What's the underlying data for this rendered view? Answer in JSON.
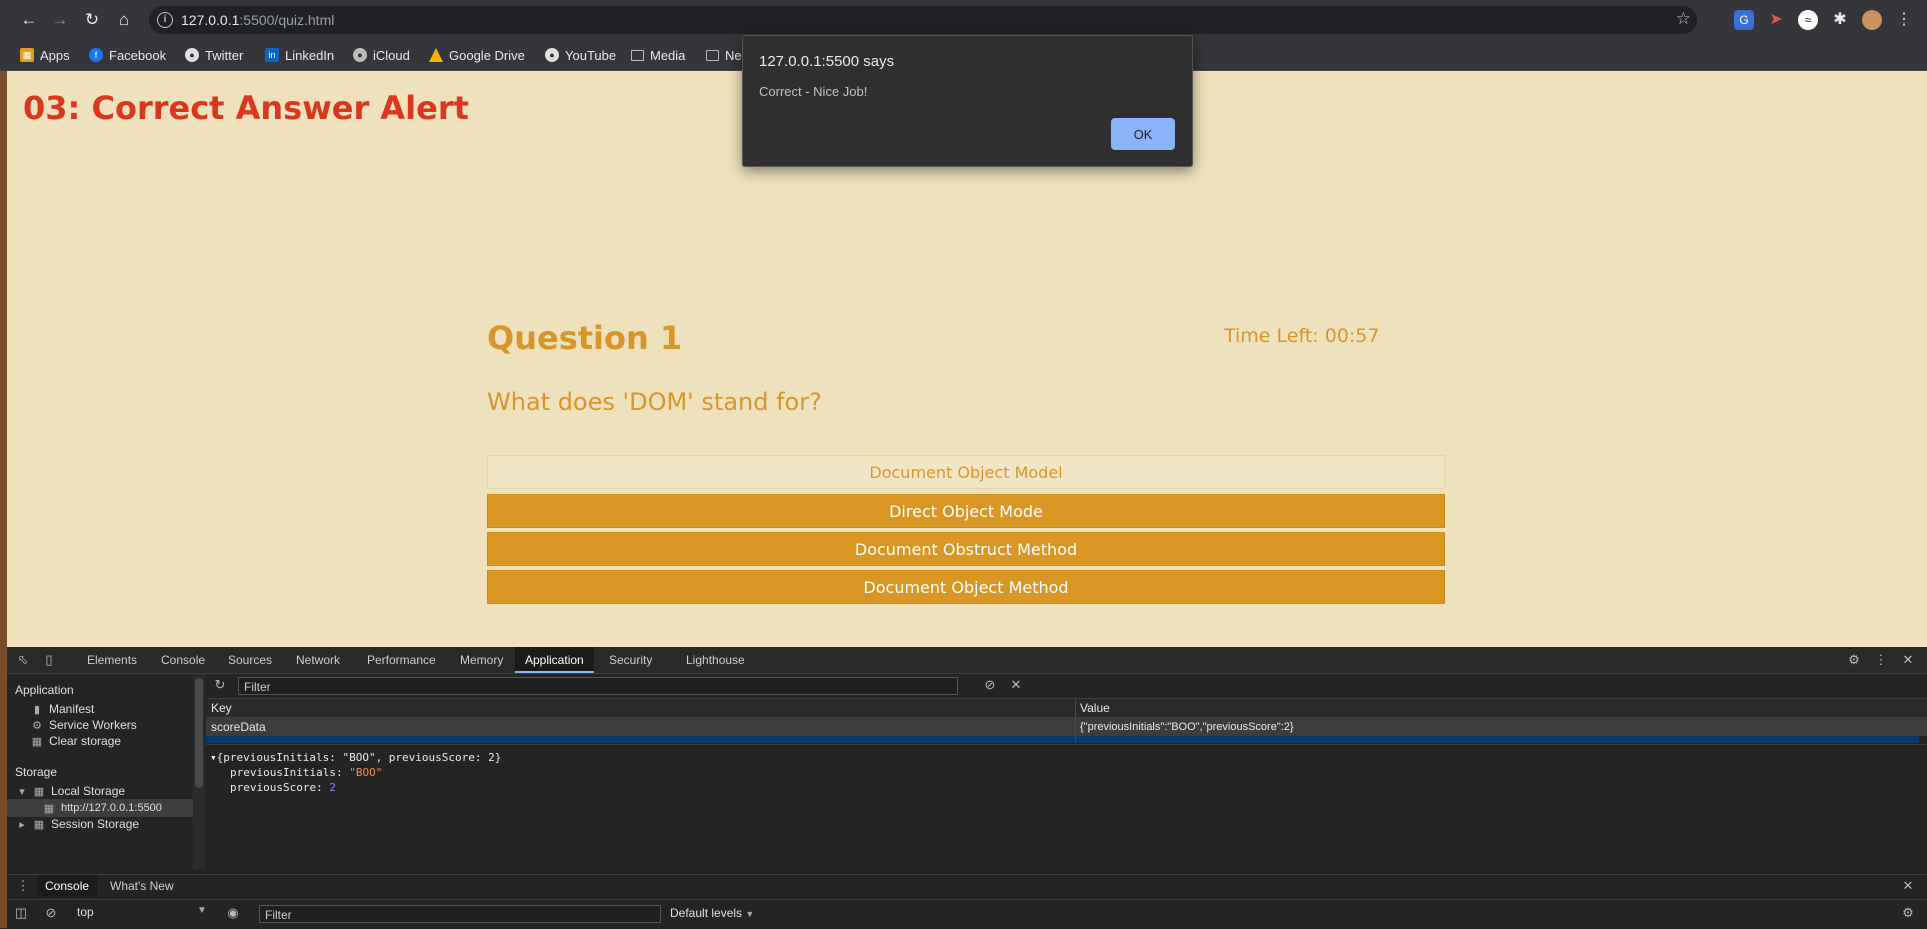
{
  "browser": {
    "url_host": "127.0.0.1",
    "url_rest": ":5500/quiz.html",
    "bookmarks": [
      "Apps",
      "Facebook",
      "Twitter",
      "LinkedIn",
      "iCloud",
      "Google Drive",
      "YouTube",
      "Media",
      "Ne"
    ]
  },
  "page": {
    "header": "03: Correct Answer Alert",
    "question_title": "Question 1",
    "timer": "Time Left: 00:57",
    "question_text": "What does 'DOM' stand for?",
    "answers": [
      "Document Object Model",
      "Direct Object Mode",
      "Document Obstruct Method",
      "Document Object Method"
    ]
  },
  "alert": {
    "title": "127.0.0.1:5500 says",
    "message": "Correct - Nice Job!",
    "ok_label": "OK"
  },
  "devtools": {
    "tabs": [
      "Elements",
      "Console",
      "Sources",
      "Network",
      "Performance",
      "Memory",
      "Application",
      "Security",
      "Lighthouse"
    ],
    "sidebar": {
      "application_heading": "Application",
      "manifest": "Manifest",
      "service_workers": "Service Workers",
      "clear_storage": "Clear storage",
      "storage_heading": "Storage",
      "local_storage": "Local Storage",
      "local_origin": "http://127.0.0.1:5500",
      "session_storage": "Session Storage"
    },
    "filter_placeholder": "Filter",
    "grid": {
      "key_header": "Key",
      "value_header": "Value",
      "row_key": "scoreData",
      "row_value": "{\"previousInitials\":\"BOO\",\"previousScore\":2}"
    },
    "preview": {
      "summary": "{previousInitials: \"BOO\", previousScore: 2}",
      "initials_key": "previousInitials: ",
      "initials_value": "\"BOO\"",
      "score_key": "previousScore: ",
      "score_value": "2"
    },
    "drawer": {
      "tab_console": "Console",
      "tab_whats_new": "What's New",
      "context": "top",
      "filter_placeholder": "Filter",
      "levels": "Default levels"
    }
  },
  "colors": {
    "page_bg": "#efe1bb",
    "header_red": "#d9381e",
    "accent_gold": "#d8962a",
    "answer_bg": "#d99623",
    "alert_ok": "#8ab4f8"
  }
}
